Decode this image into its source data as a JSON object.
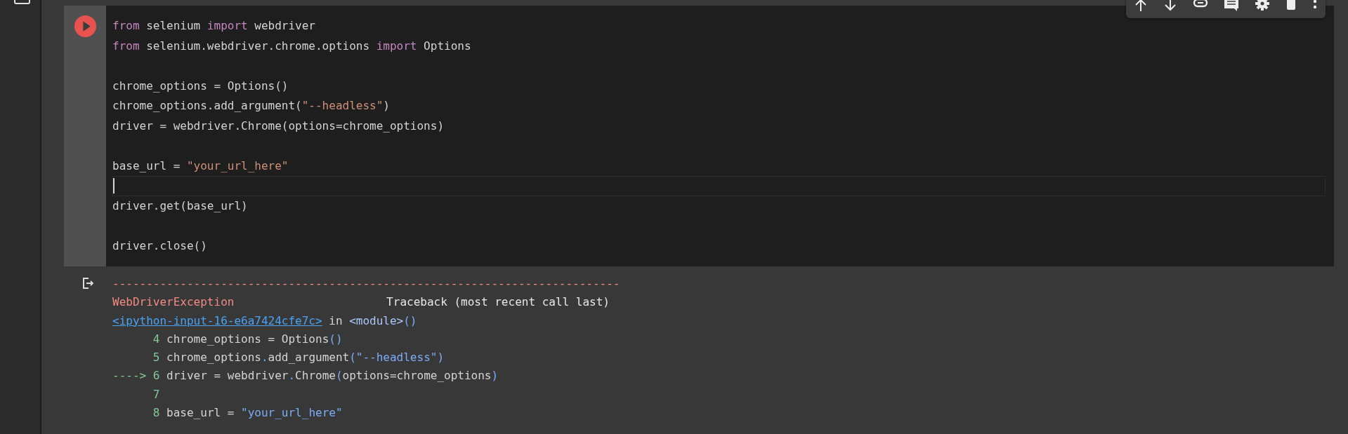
{
  "cell": {
    "running": false,
    "code_lines": [
      {
        "kind": "code",
        "tokens": [
          {
            "t": "from",
            "kind": "keyword"
          },
          {
            "t": " selenium ",
            "kind": "plain"
          },
          {
            "t": "import",
            "kind": "keyword"
          },
          {
            "t": " webdriver",
            "kind": "plain"
          }
        ]
      },
      {
        "kind": "code",
        "tokens": [
          {
            "t": "from",
            "kind": "keyword"
          },
          {
            "t": " selenium.webdriver.chrome.options ",
            "kind": "plain"
          },
          {
            "t": "import",
            "kind": "keyword"
          },
          {
            "t": " Options",
            "kind": "plain"
          }
        ]
      },
      {
        "kind": "blank"
      },
      {
        "kind": "code",
        "tokens": [
          {
            "t": "chrome_options = Options()",
            "kind": "plain"
          }
        ]
      },
      {
        "kind": "code",
        "tokens": [
          {
            "t": "chrome_options.add_argument(",
            "kind": "plain"
          },
          {
            "t": "\"--headless\"",
            "kind": "string"
          },
          {
            "t": ")",
            "kind": "plain"
          }
        ]
      },
      {
        "kind": "code",
        "tokens": [
          {
            "t": "driver = webdriver.Chrome(options=chrome_options)",
            "kind": "plain"
          }
        ]
      },
      {
        "kind": "blank"
      },
      {
        "kind": "code",
        "tokens": [
          {
            "t": "base_url = ",
            "kind": "plain"
          },
          {
            "t": "\"your_url_here\"",
            "kind": "string"
          }
        ]
      },
      {
        "kind": "cursor"
      },
      {
        "kind": "code",
        "tokens": [
          {
            "t": "driver.get(base_url)",
            "kind": "plain"
          }
        ]
      },
      {
        "kind": "blank"
      },
      {
        "kind": "code",
        "tokens": [
          {
            "t": "driver.close()",
            "kind": "plain"
          }
        ]
      }
    ],
    "output_lines": [
      {
        "kind": "rule",
        "text": "---------------------------------------------------------------------------"
      },
      {
        "kind": "header",
        "name": "WebDriverException",
        "note": "Traceback (most recent call last)"
      },
      {
        "kind": "location",
        "link": "<ipython-input-16-e6a7424cfe7c>",
        "tokens": [
          {
            "t": " in ",
            "kind": "plain"
          },
          {
            "t": "<module>",
            "kind": "module"
          },
          {
            "t": "()",
            "kind": "punct"
          }
        ]
      },
      {
        "kind": "source",
        "number": "4",
        "tokens": [
          {
            "t": "chrome_options = Options",
            "kind": "plain"
          },
          {
            "t": "()",
            "kind": "punct"
          }
        ]
      },
      {
        "kind": "source",
        "number": "5",
        "tokens": [
          {
            "t": "chrome_options",
            "kind": "plain"
          },
          {
            "t": ".",
            "kind": "punct"
          },
          {
            "t": "add_argument",
            "kind": "plain"
          },
          {
            "t": "(\"--headless\")",
            "kind": "punct"
          }
        ]
      },
      {
        "kind": "source",
        "arrow": "---->",
        "number": "6",
        "tokens": [
          {
            "t": "driver = webdriver",
            "kind": "plain"
          },
          {
            "t": ".",
            "kind": "punct"
          },
          {
            "t": "Chrome",
            "kind": "plain"
          },
          {
            "t": "(",
            "kind": "punct"
          },
          {
            "t": "options=chrome_options",
            "kind": "plain"
          },
          {
            "t": ")",
            "kind": "punct"
          }
        ]
      },
      {
        "kind": "source",
        "number": "7"
      },
      {
        "kind": "source",
        "number": "8",
        "tokens": [
          {
            "t": "base_url = ",
            "kind": "plain"
          },
          {
            "t": "\"your_url_here\"",
            "kind": "punct"
          }
        ]
      }
    ]
  }
}
